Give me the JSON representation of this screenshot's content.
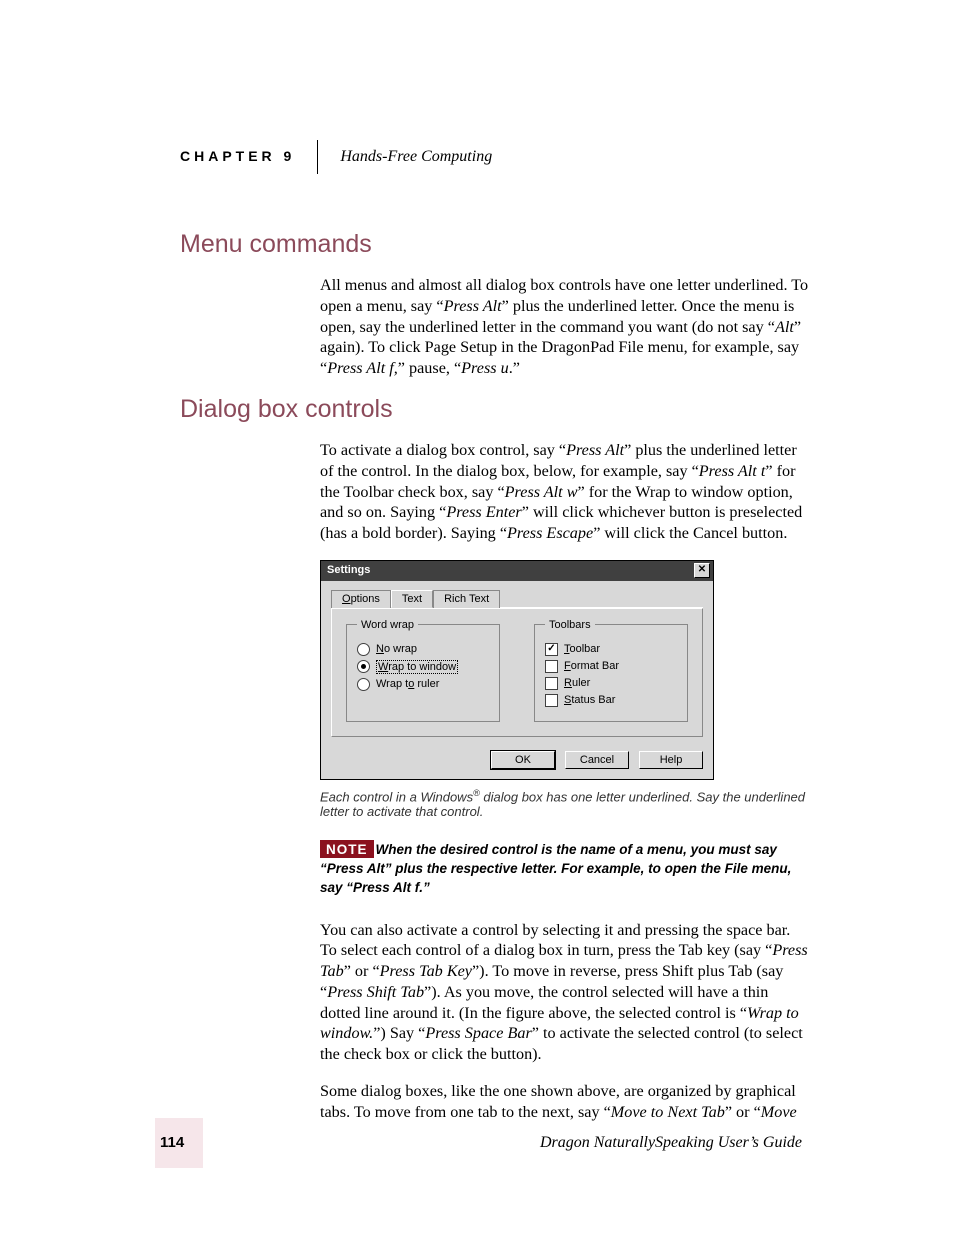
{
  "header": {
    "chapter_label": "CHAPTER 9",
    "chapter_title": "Hands-Free Computing"
  },
  "section1": {
    "heading": "Menu commands",
    "para1_a": "All menus and almost all dialog box controls have one letter underlined. To open a menu, say “",
    "para1_i1": "Press Alt",
    "para1_b": "” plus the underlined letter. Once the menu is open, say the underlined letter in the command you want (do not say “",
    "para1_i2": "Alt",
    "para1_c": "” again). To click Page Setup in the DragonPad File menu, for example, say “",
    "para1_i3": "Press Alt f,",
    "para1_d": "” pause, “",
    "para1_i4": "Press u",
    "para1_e": ".”"
  },
  "section2": {
    "heading": "Dialog box controls",
    "para1_a": "To activate a dialog box control, say “",
    "para1_i1": "Press Alt",
    "para1_b": "” plus the underlined letter of the control. In the dialog box, below, for example, say “",
    "para1_i2": "Press Alt t",
    "para1_c": "” for the Toolbar check box, say “",
    "para1_i3": "Press Alt w",
    "para1_d": "” for the Wrap to window option, and so on. Saying “",
    "para1_i4": "Press Enter",
    "para1_e": "” will click whichever button is preselected (has a bold border). Saying “",
    "para1_i5": "Press Escape",
    "para1_f": "” will click the Cancel button."
  },
  "dialog": {
    "title": "Settings",
    "tabs": [
      "Options",
      "Text",
      "Rich Text"
    ],
    "active_tab_index": 1,
    "groupbox_left": "Word wrap",
    "radio_options": [
      {
        "label_pre": "",
        "u": "N",
        "label_post": "o wrap",
        "selected": false,
        "focused": false
      },
      {
        "label_pre": "",
        "u": "W",
        "label_post": "rap to window",
        "selected": true,
        "focused": true
      },
      {
        "label_pre": "Wrap t",
        "u": "o",
        "label_post": " ruler",
        "selected": false,
        "focused": false
      }
    ],
    "groupbox_right": "Toolbars",
    "checkbox_options": [
      {
        "u": "T",
        "label_post": "oolbar",
        "checked": true
      },
      {
        "u": "F",
        "label_post": "ormat Bar",
        "checked": false
      },
      {
        "u": "R",
        "label_post": "uler",
        "checked": false
      },
      {
        "u": "S",
        "label_post": "tatus Bar",
        "checked": false
      }
    ],
    "buttons": {
      "ok": "OK",
      "cancel": "Cancel",
      "help": "Help"
    }
  },
  "caption_a": "Each control in a Windows",
  "caption_b": " dialog box has one letter underlined. Say the underlined letter to activate that control.",
  "note": {
    "badge": "NOTE",
    "text": "When the desired control is the name of a menu, you must say “Press Alt” plus the respective letter. For example, to open the File menu, say “Press Alt f.”"
  },
  "para3_a": "You can also activate a control by selecting it and pressing the space bar. To select each control of a dialog box in turn, press the Tab key (say “",
  "para3_i1": "Press Tab",
  "para3_b": "” or “",
  "para3_i2": "Press Tab Key",
  "para3_c": "”). To move in reverse, press Shift plus Tab (say “",
  "para3_i3": "Press Shift Tab",
  "para3_d": "”). As you move, the control selected will have a thin dotted line around it. (In the figure above, the selected control is “",
  "para3_i4": "Wrap to window.",
  "para3_e": "”) Say “",
  "para3_i5": "Press Space Bar",
  "para3_f": "” to activate the selected control (to select the check box or click the button).",
  "para4_a": "Some dialog boxes, like the one shown above, are organized by graphical tabs. To move from one tab to the next, say “",
  "para4_i1": "Move to Next Tab",
  "para4_b": "” or “",
  "para4_i2": "Move",
  "footer": {
    "page_number": "114",
    "book_title": "Dragon NaturallySpeaking User’s Guide"
  }
}
